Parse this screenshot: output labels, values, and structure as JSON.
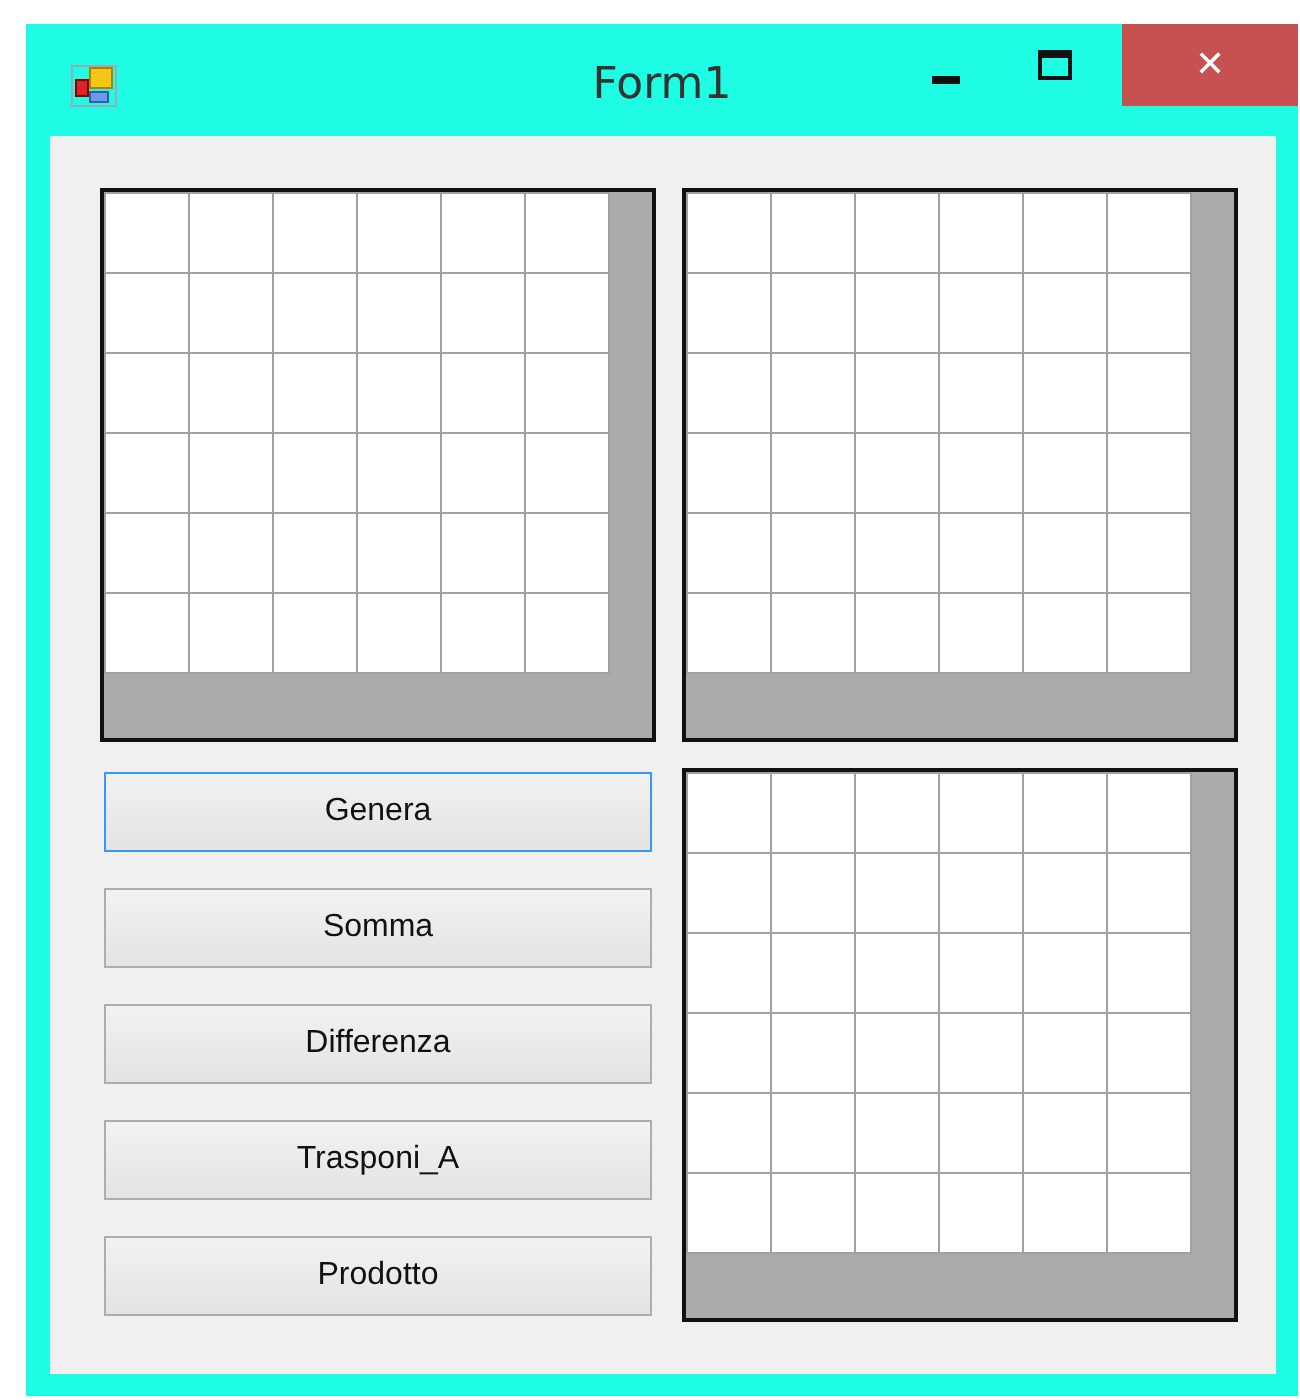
{
  "window": {
    "title": "Form1",
    "close_symbol": "✕"
  },
  "grids": [
    {
      "kind": "empty_grid"
    },
    {
      "kind": "empty_grid"
    },
    {
      "kind": "empty_grid"
    }
  ],
  "buttons": [
    {
      "label": "Genera",
      "focused": true
    },
    {
      "label": "Somma",
      "focused": false
    },
    {
      "label": "Differenza",
      "focused": false
    },
    {
      "label": "Trasponi_A",
      "focused": false
    },
    {
      "label": "Prodotto",
      "focused": false
    }
  ]
}
